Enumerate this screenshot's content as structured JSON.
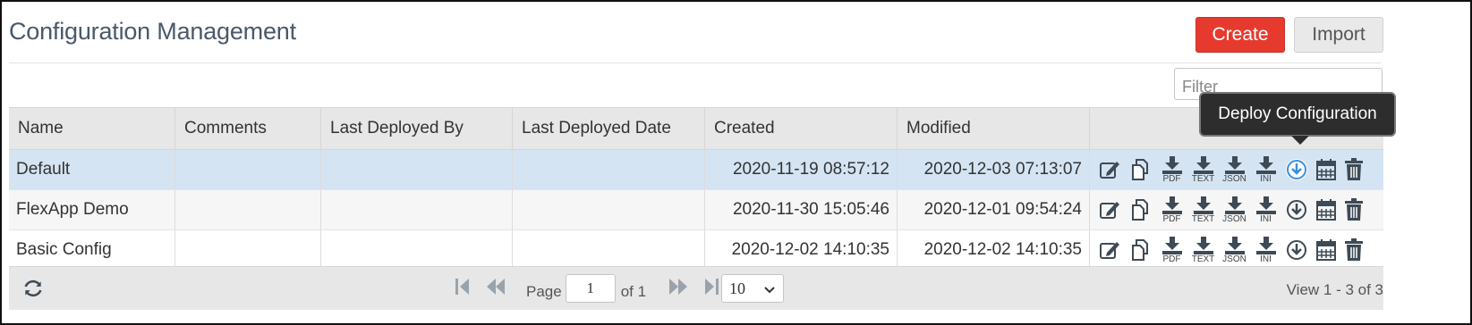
{
  "page": {
    "title": "Configuration Management",
    "create_label": "Create",
    "import_label": "Import",
    "filter_placeholder": "Filter"
  },
  "table": {
    "columns": [
      "Name",
      "Comments",
      "Last Deployed By",
      "Last Deployed Date",
      "Created",
      "Modified",
      ""
    ],
    "rows": [
      {
        "name": "Default",
        "comments": "",
        "last_deployed_by": "",
        "last_deployed_date": "",
        "created": "2020-11-19 08:57:12",
        "modified": "2020-12-03 07:13:07",
        "selected": true
      },
      {
        "name": "FlexApp Demo",
        "comments": "",
        "last_deployed_by": "",
        "last_deployed_date": "",
        "created": "2020-11-30 15:05:46",
        "modified": "2020-12-01 09:54:24",
        "selected": false
      },
      {
        "name": "Basic Config",
        "comments": "",
        "last_deployed_by": "",
        "last_deployed_date": "",
        "created": "2020-12-02 14:10:35",
        "modified": "2020-12-02 14:10:35",
        "selected": false
      }
    ],
    "row_actions": [
      {
        "icon": "edit-icon",
        "label": ""
      },
      {
        "icon": "copy-icon",
        "label": ""
      },
      {
        "icon": "download-icon",
        "label": "PDF"
      },
      {
        "icon": "download-icon",
        "label": "TEXT"
      },
      {
        "icon": "download-icon",
        "label": "JSON"
      },
      {
        "icon": "download-icon",
        "label": "INI"
      },
      {
        "icon": "deploy-icon",
        "label": ""
      },
      {
        "icon": "calendar-icon",
        "label": ""
      },
      {
        "icon": "trash-icon",
        "label": ""
      }
    ]
  },
  "tooltip": {
    "text": "Deploy Configuration"
  },
  "pager": {
    "page_label": "Page",
    "page_value": "1",
    "of_label": "of 1",
    "page_size": "10",
    "view_info": "View 1 - 3 of 3"
  },
  "colors": {
    "accent": "#e63a2e",
    "selected_row": "#d4e4f3",
    "header_bg": "#e7e7e7",
    "icon": "#3e4a55",
    "deploy_highlight": "#3a8fdc"
  }
}
